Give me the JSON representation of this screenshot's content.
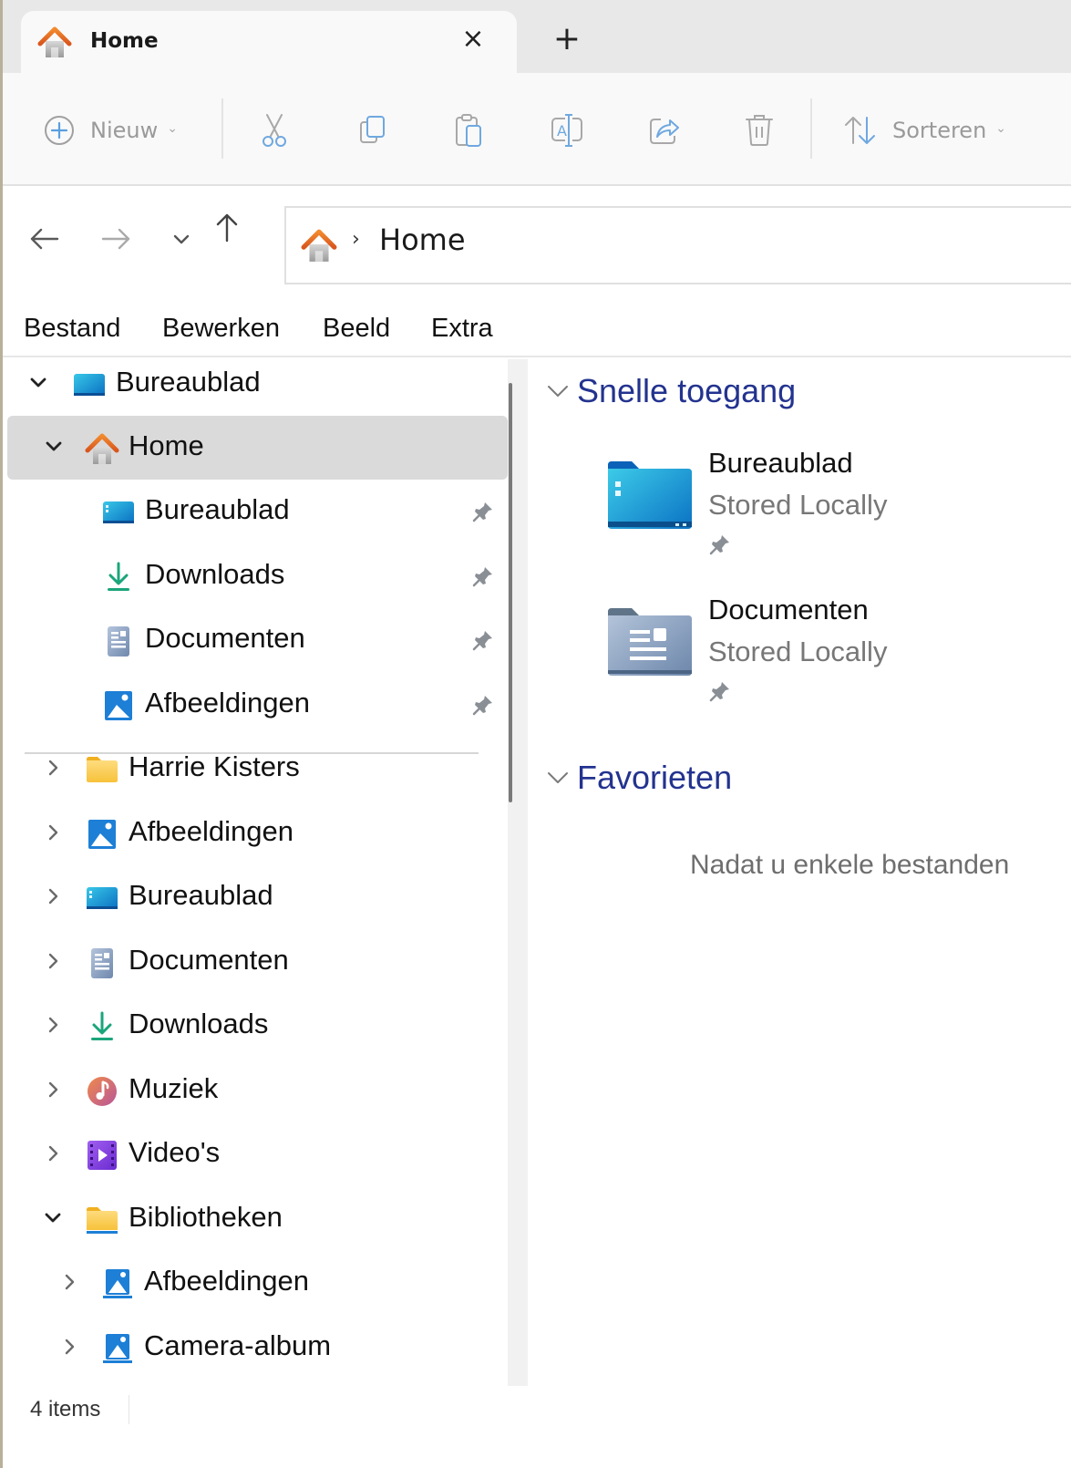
{
  "tabs": [
    {
      "title": "Home",
      "icon": "home-icon",
      "active": true
    }
  ],
  "tabstrip": {
    "close_label": "×",
    "new_tab_label": "+"
  },
  "toolbar": {
    "new_label": "Nieuw",
    "sort_label": "Sorteren",
    "buttons": [
      "cut-icon",
      "copy-icon",
      "paste-icon",
      "rename-icon",
      "share-icon",
      "delete-icon"
    ]
  },
  "navigation": {
    "back": "back-icon",
    "forward": "forward-icon",
    "recent": "recent-locations-icon",
    "up": "up-icon"
  },
  "address": {
    "breadcrumb_separator": "›",
    "current": "Home"
  },
  "menu": {
    "items": [
      "Bestand",
      "Bewerken",
      "Beeld",
      "Extra"
    ]
  },
  "tree": {
    "items": [
      {
        "label": "Bureaublad",
        "icon": "desktop-icon",
        "expanded": true,
        "level": 0,
        "pinned": false
      },
      {
        "label": "Home",
        "icon": "home-icon",
        "expanded": true,
        "level": 1,
        "selected": true,
        "pinned": false
      },
      {
        "label": "Bureaublad",
        "icon": "desktop-icon",
        "level": 2,
        "pinned": true
      },
      {
        "label": "Downloads",
        "icon": "download-icon",
        "level": 2,
        "pinned": true
      },
      {
        "label": "Documenten",
        "icon": "document-icon",
        "level": 2,
        "pinned": true
      },
      {
        "label": "Afbeeldingen",
        "icon": "pictures-icon",
        "level": 2,
        "pinned": true
      },
      {
        "label": "Harrie Kisters",
        "icon": "folder-icon",
        "expanded": false,
        "level": 1
      },
      {
        "label": "Afbeeldingen",
        "icon": "pictures-icon",
        "expanded": false,
        "level": 1
      },
      {
        "label": "Bureaublad",
        "icon": "desktop-icon",
        "expanded": false,
        "level": 1
      },
      {
        "label": "Documenten",
        "icon": "document-icon",
        "expanded": false,
        "level": 1
      },
      {
        "label": "Downloads",
        "icon": "download-icon",
        "expanded": false,
        "level": 1
      },
      {
        "label": "Muziek",
        "icon": "music-icon",
        "expanded": false,
        "level": 1
      },
      {
        "label": "Video's",
        "icon": "video-icon",
        "expanded": false,
        "level": 1
      },
      {
        "label": "Bibliotheken",
        "icon": "folder-icon",
        "expanded": true,
        "level": 1
      },
      {
        "label": "Afbeeldingen",
        "icon": "pictures-icon",
        "expanded": false,
        "level": 2
      },
      {
        "label": "Camera-album",
        "icon": "pictures-icon",
        "expanded": false,
        "level": 2
      }
    ]
  },
  "content": {
    "groups": [
      {
        "title": "Snelle toegang",
        "items": [
          {
            "name": "Bureaublad",
            "status": "Stored Locally",
            "icon": "desktop-folder-icon",
            "pinned": true
          },
          {
            "name": "Documenten",
            "status": "Stored Locally",
            "icon": "documents-folder-icon",
            "pinned": true
          }
        ]
      },
      {
        "title": "Favorieten",
        "empty_text": "Nadat u enkele bestanden"
      }
    ]
  },
  "status": {
    "item_count": "4 items"
  },
  "colors": {
    "group_title": "#23338f",
    "selection": "#dadada",
    "accent_orange": "#e8702a",
    "download_green": "#1aa57a",
    "picture_blue": "#1d7fd6"
  }
}
